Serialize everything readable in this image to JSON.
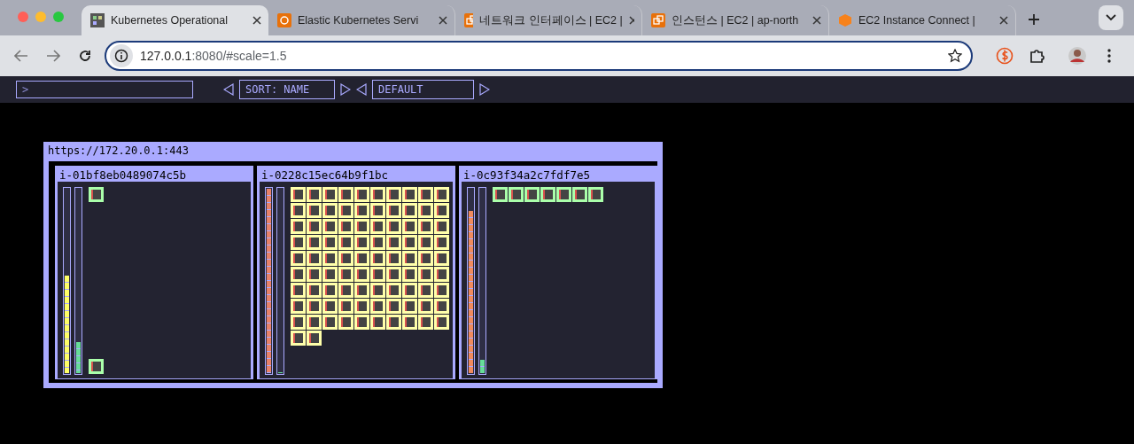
{
  "browser": {
    "tabs": [
      {
        "title": "Kubernetes Operational",
        "selected": true,
        "kind": "grid"
      },
      {
        "title": "Elastic Kubernetes Servi",
        "selected": false,
        "kind": "service"
      },
      {
        "title": "네트워크 인터페이스 | EC2 |",
        "selected": false,
        "kind": "instance"
      },
      {
        "title": "인스턴스 | EC2 | ap-north",
        "selected": false,
        "kind": "instance"
      },
      {
        "title": "EC2 Instance Connect |",
        "selected": false,
        "kind": "cube"
      }
    ],
    "url": {
      "host": "127.0.0.1",
      "path": ":8080/#scale=1.5"
    }
  },
  "toolbar": {
    "filter": ">",
    "sort": "SORT: NAME",
    "theme": "DEFAULT"
  },
  "cluster": {
    "title": "https://172.20.0.1:443",
    "nodes": [
      {
        "name": "i-01bf8eb0489074c5b",
        "cpu": {
          "level": 0.53,
          "color": "#ffff66"
        },
        "memory": {
          "level": 0.17
        },
        "pods": [
          {
            "color": "#aaffaa"
          }
        ],
        "system_pods": [
          {
            "color": "#aaffaa"
          }
        ]
      },
      {
        "name": "i-0228c15ec64b9f1bc",
        "cpu": {
          "level": 1,
          "color": "#e8826a"
        },
        "memory": {
          "level": 0
        },
        "pods": [
          {
            "color": "#ffffaa"
          },
          {
            "color": "#ffffaa"
          },
          {
            "color": "#ffffaa"
          },
          {
            "color": "#ffffaa"
          },
          {
            "color": "#ffffaa"
          },
          {
            "color": "#ffffaa"
          },
          {
            "color": "#ffffaa"
          },
          {
            "color": "#ffffaa"
          },
          {
            "color": "#ffffaa"
          },
          {
            "color": "#ffffaa"
          },
          {
            "color": "#ffffaa"
          },
          {
            "color": "#ffffaa"
          },
          {
            "color": "#ffffaa"
          },
          {
            "color": "#ffffaa"
          },
          {
            "color": "#ffffaa"
          },
          {
            "color": "#ffffaa"
          },
          {
            "color": "#ffffaa"
          },
          {
            "color": "#ffffaa"
          },
          {
            "color": "#ffffaa"
          },
          {
            "color": "#ffffaa"
          },
          {
            "color": "#ffffaa"
          },
          {
            "color": "#ffffaa"
          },
          {
            "color": "#ffffaa"
          },
          {
            "color": "#ffffaa"
          },
          {
            "color": "#ffffaa"
          },
          {
            "color": "#ffffaa"
          },
          {
            "color": "#ffffaa"
          },
          {
            "color": "#ffffaa"
          },
          {
            "color": "#ffffaa"
          },
          {
            "color": "#ffffaa"
          },
          {
            "color": "#ffffaa"
          },
          {
            "color": "#ffffaa"
          },
          {
            "color": "#ffffaa"
          },
          {
            "color": "#ffffaa"
          },
          {
            "color": "#ffffaa"
          },
          {
            "color": "#ffffaa"
          },
          {
            "color": "#ffffaa"
          },
          {
            "color": "#ffffaa"
          },
          {
            "color": "#ffffaa"
          },
          {
            "color": "#ffffaa"
          },
          {
            "color": "#ffffaa"
          },
          {
            "color": "#ffffaa"
          },
          {
            "color": "#ffffaa"
          },
          {
            "color": "#ffffaa"
          },
          {
            "color": "#ffffaa"
          },
          {
            "color": "#ffffaa"
          },
          {
            "color": "#ffffaa"
          },
          {
            "color": "#ffffaa"
          },
          {
            "color": "#ffffaa"
          },
          {
            "color": "#ffffaa"
          },
          {
            "color": "#ffffaa"
          },
          {
            "color": "#ffffaa"
          },
          {
            "color": "#ffffaa"
          },
          {
            "color": "#ffffaa"
          },
          {
            "color": "#ffffaa"
          },
          {
            "color": "#ffffaa"
          },
          {
            "color": "#ffffaa"
          },
          {
            "color": "#ffffaa"
          },
          {
            "color": "#ffffaa"
          },
          {
            "color": "#ffffaa"
          },
          {
            "color": "#ffffaa"
          },
          {
            "color": "#ffffaa"
          },
          {
            "color": "#ffffaa"
          },
          {
            "color": "#ffffaa"
          },
          {
            "color": "#ffffaa"
          },
          {
            "color": "#ffffaa"
          },
          {
            "color": "#ffffaa"
          },
          {
            "color": "#ffffaa"
          },
          {
            "color": "#ffffaa"
          },
          {
            "color": "#ffffaa"
          },
          {
            "color": "#ffffaa"
          },
          {
            "color": "#ffffaa"
          },
          {
            "color": "#ffffaa"
          },
          {
            "color": "#ffffaa"
          },
          {
            "color": "#ffffaa"
          },
          {
            "color": "#ffffaa"
          },
          {
            "color": "#ffffaa"
          },
          {
            "color": "#ffffaa"
          },
          {
            "color": "#ffffaa"
          },
          {
            "color": "#ffffaa"
          },
          {
            "color": "#ffffaa"
          },
          {
            "color": "#ffffaa"
          },
          {
            "color": "#ffffaa"
          },
          {
            "color": "#ffffaa"
          },
          {
            "color": "#ffffaa"
          },
          {
            "color": "#ffffaa"
          },
          {
            "color": "#ffffaa"
          },
          {
            "color": "#ffffaa"
          },
          {
            "color": "#ffffaa"
          },
          {
            "color": "#ffffaa"
          },
          {
            "color": "#ffffaa"
          },
          {
            "color": "#ffffaa"
          }
        ]
      },
      {
        "name": "i-0c93f34a2c7fdf7e5",
        "cpu": {
          "level": 0.88,
          "color": "#f08a5d"
        },
        "memory": {
          "level": 0.07
        },
        "pods": [
          {
            "color": "#aaffaa"
          },
          {
            "color": "#aaffaa"
          },
          {
            "color": "#aaffaa"
          },
          {
            "color": "#aaffaa"
          },
          {
            "color": "#aaffaa"
          },
          {
            "color": "#aaffaa"
          },
          {
            "color": "#aaffaa"
          }
        ]
      }
    ]
  }
}
